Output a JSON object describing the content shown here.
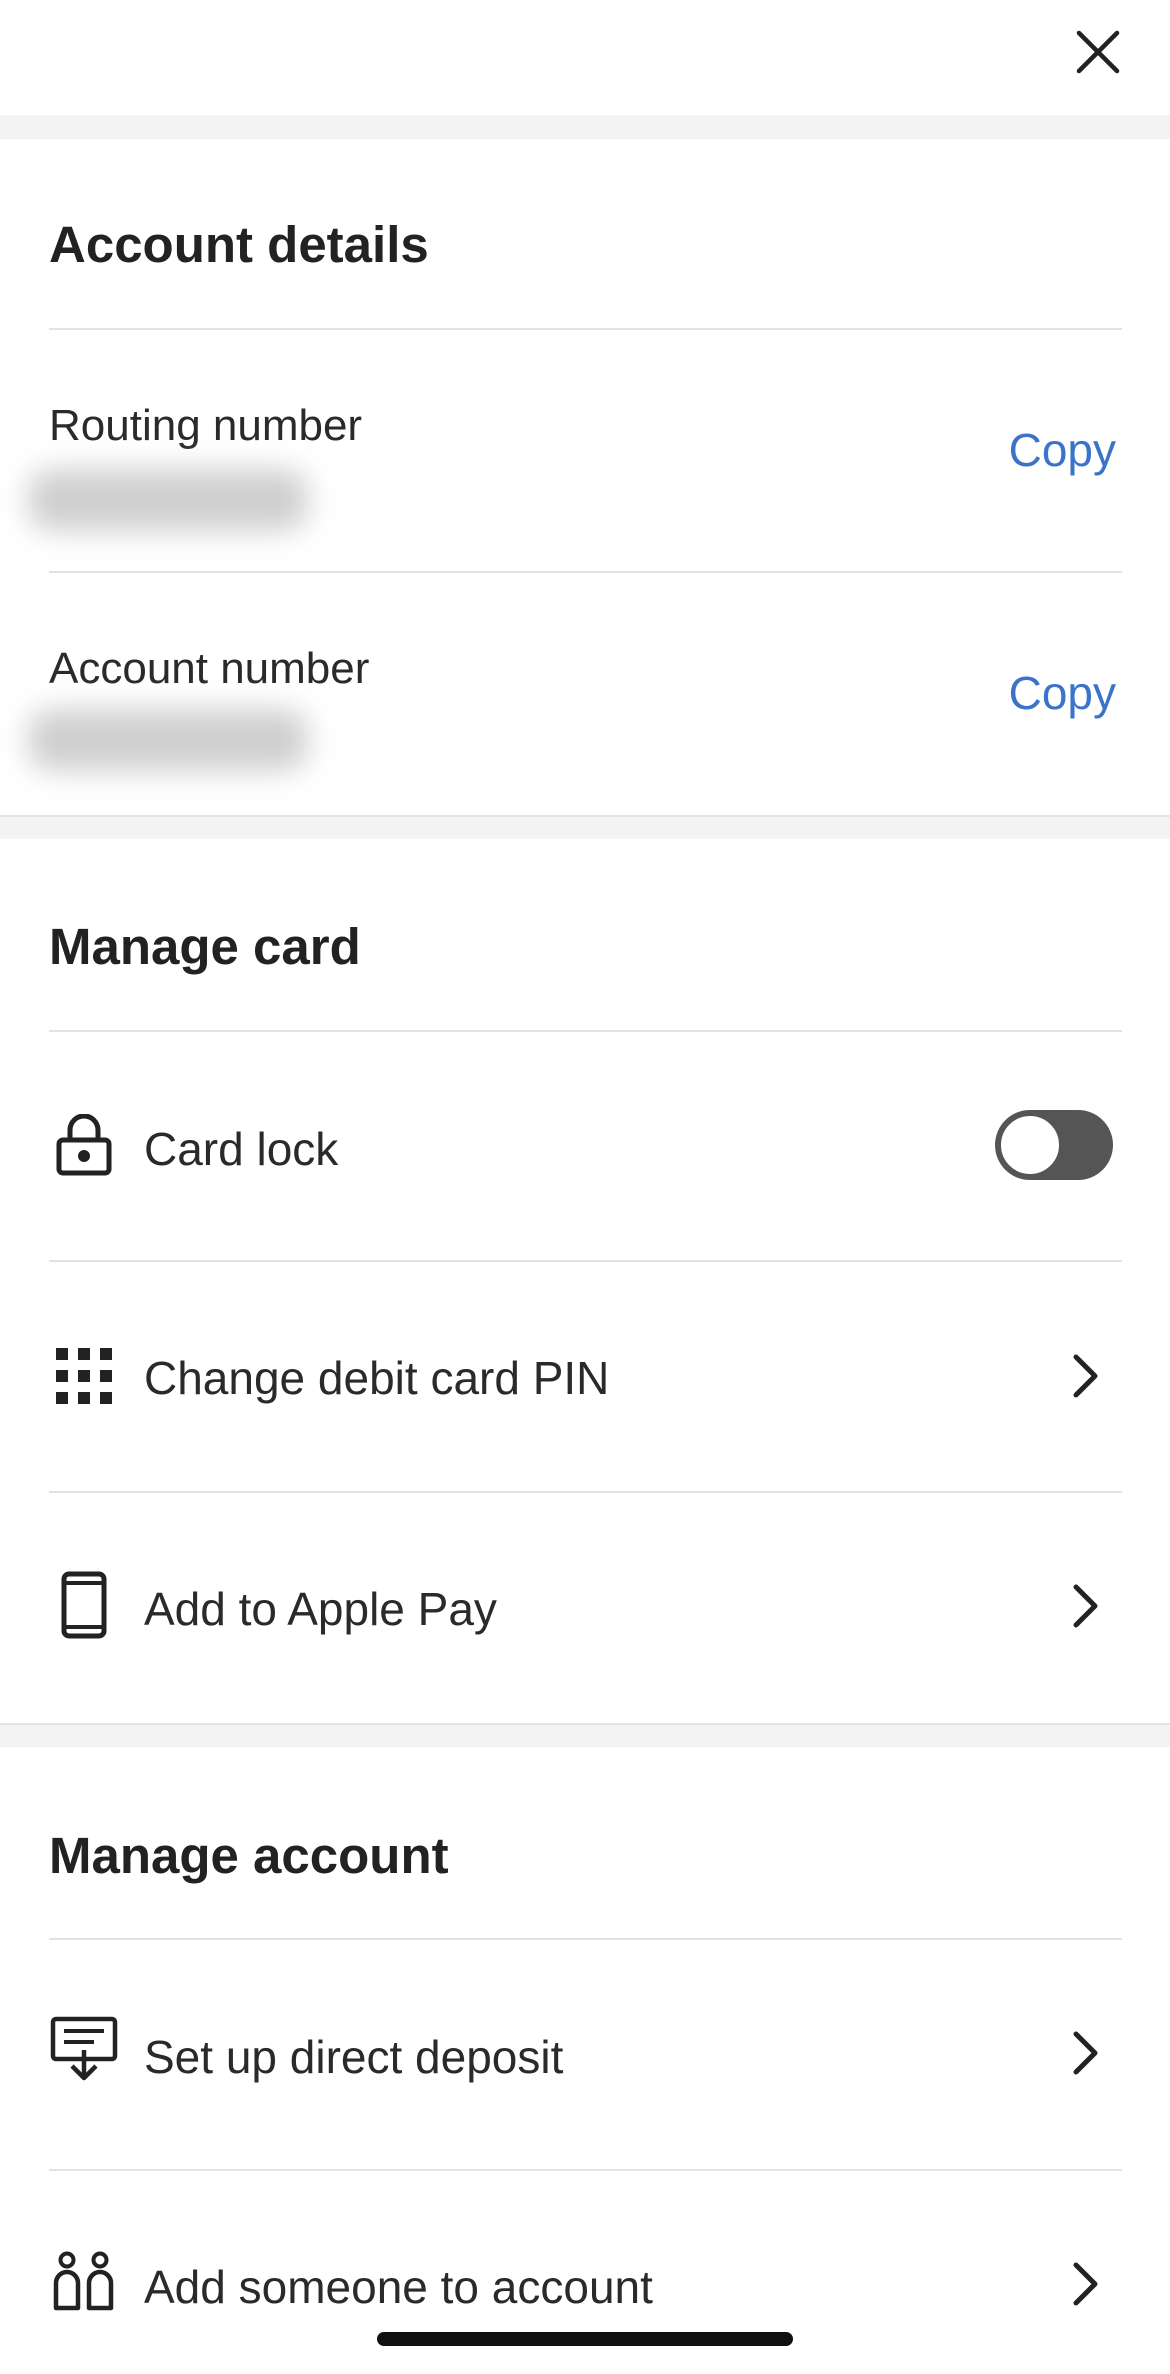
{
  "header": {
    "close_icon": "close-icon"
  },
  "account_details": {
    "title": "Account details",
    "routing": {
      "label": "Routing number",
      "copy_label": "Copy"
    },
    "account": {
      "label": "Account number",
      "copy_label": "Copy"
    }
  },
  "manage_card": {
    "title": "Manage card",
    "items": [
      {
        "label": "Card lock",
        "icon": "lock-icon",
        "control": "toggle",
        "toggle_on": false
      },
      {
        "label": "Change debit card PIN",
        "icon": "keypad-icon",
        "control": "chevron"
      },
      {
        "label": "Add to Apple Pay",
        "icon": "phone-icon",
        "control": "chevron"
      }
    ]
  },
  "manage_account": {
    "title": "Manage account",
    "items": [
      {
        "label": "Set up direct deposit",
        "icon": "deposit-icon",
        "control": "chevron"
      },
      {
        "label": "Add someone to account",
        "icon": "people-icon",
        "control": "chevron"
      }
    ]
  },
  "colors": {
    "link": "#3a73c9",
    "toggle_track": "#555555",
    "section_gap": "#f3f3f3",
    "divider": "#e3e3e3"
  }
}
